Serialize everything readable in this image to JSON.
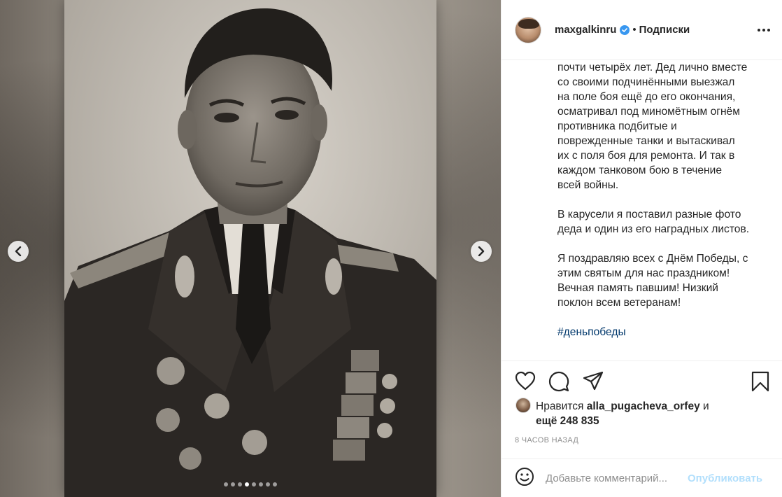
{
  "post": {
    "media": {
      "alt": "",
      "carousel_count": 8,
      "active_index": 3
    },
    "author": {
      "username": "maxgalkinru",
      "verified": true,
      "separator": "•",
      "follow_label": "Подписки"
    },
    "caption": {
      "paragraphs": [
        [
          "почти четырёх лет. Дед лично вместе",
          "со своими подчинёнными выезжал",
          "на поле боя ещё до его окончания,",
          "осматривал под миномётным огнём",
          "противника подбитые и",
          "поврежденные танки и вытаскивал",
          "их с поля боя для ремонта. И так в",
          "каждом танковом бою в течение",
          "всей войны."
        ],
        [
          "В карусели я поставил разные фото",
          "деда и один из его наградных листов."
        ],
        [
          "Я поздравляю всех с Днём Победы, с",
          "этим святым для нас праздником!",
          "Вечная память павшим! Низкий",
          "поклон всем ветеранам!"
        ]
      ],
      "hashtag": "#деньпобеды"
    },
    "likes": {
      "prefix": "Нравится",
      "user": "alla_pugacheva_orfey",
      "conjunction": "и",
      "others": "ещё 248 835"
    },
    "time": "8 часов назад",
    "comment": {
      "placeholder": "Добавьте комментарий...",
      "publish_label": "Опубликовать"
    },
    "colors": {
      "link_blue": "#00376b",
      "publish_disabled": "#b2dffc",
      "verified": "#3897f0",
      "muted": "#8e8e8e"
    },
    "icons": [
      "heart-icon",
      "comment-icon",
      "share-icon",
      "bookmark-icon",
      "more-icon",
      "emoji-icon",
      "chevron-left-icon",
      "chevron-right-icon",
      "verified-icon"
    ]
  }
}
